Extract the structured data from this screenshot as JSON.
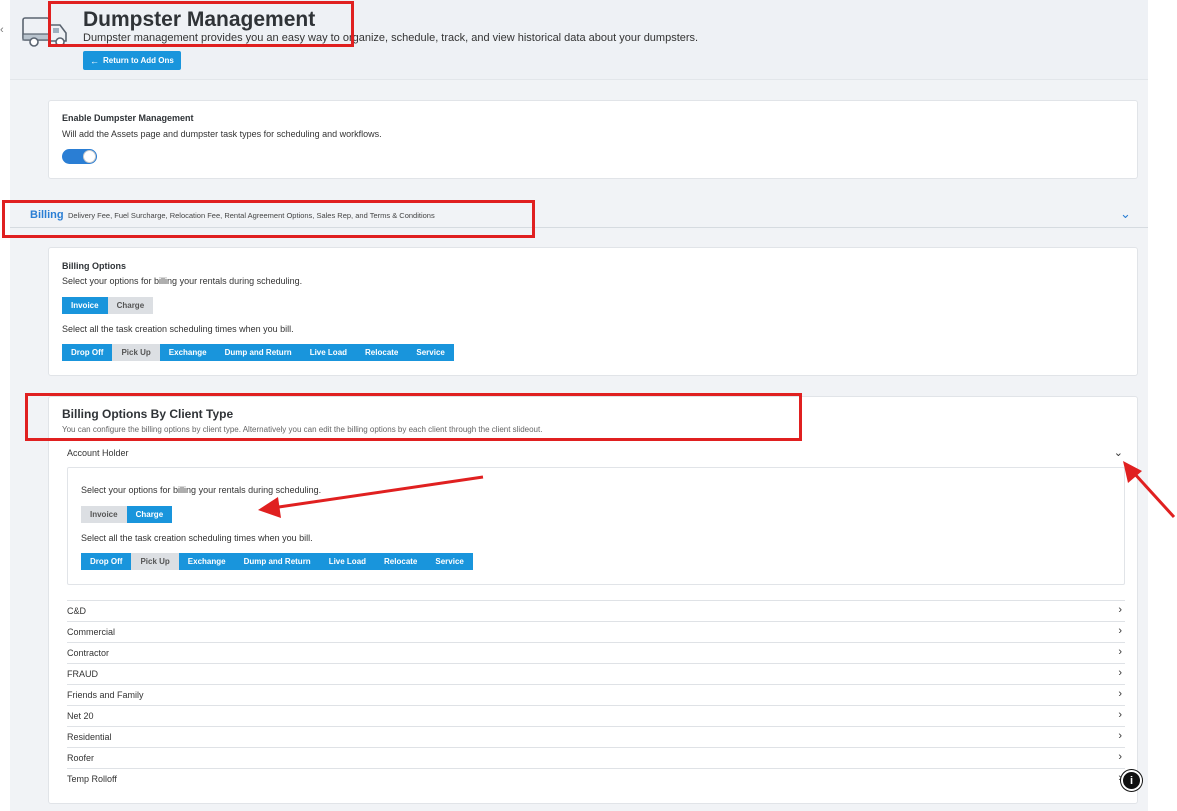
{
  "header": {
    "title": "Dumpster Management",
    "subtitle": "Dumpster management provides you an easy way to organize, schedule, track, and view historical data about your dumpsters.",
    "back_label": "Return to Add Ons",
    "logo_icon": "dumpster-truck-icon"
  },
  "enable_card": {
    "title": "Enable Dumpster Management",
    "description": "Will add the Assets page and dumpster task types for scheduling and workflows.",
    "enabled": true
  },
  "billing_section": {
    "name": "Billing",
    "description": "Delivery Fee, Fuel Surcharge, Relocation Fee, Rental Agreement Options, Sales Rep, and Terms & Conditions",
    "expanded": true
  },
  "billing_options": {
    "title": "Billing Options",
    "prompt": "Select your options for billing your rentals during scheduling.",
    "bill_types": [
      {
        "label": "Invoice",
        "selected": true
      },
      {
        "label": "Charge",
        "selected": false
      }
    ],
    "times_prompt": "Select all the task creation scheduling times when you bill.",
    "task_types": [
      {
        "label": "Drop Off",
        "selected": true
      },
      {
        "label": "Pick Up",
        "selected": false
      },
      {
        "label": "Exchange",
        "selected": true
      },
      {
        "label": "Dump and Return",
        "selected": true
      },
      {
        "label": "Live Load",
        "selected": true
      },
      {
        "label": "Relocate",
        "selected": true
      },
      {
        "label": "Service",
        "selected": true
      }
    ]
  },
  "client_type_billing": {
    "title": "Billing Options By Client Type",
    "description": "You can configure the billing options by client type. Alternatively you can edit the billing options by each client through the client slideout.",
    "expanded_client": {
      "name": "Account Holder",
      "prompt": "Select your options for billing your rentals during scheduling.",
      "bill_types": [
        {
          "label": "Invoice",
          "selected": false
        },
        {
          "label": "Charge",
          "selected": true
        }
      ],
      "times_prompt": "Select all the task creation scheduling times when you bill.",
      "task_types": [
        {
          "label": "Drop Off",
          "selected": true
        },
        {
          "label": "Pick Up",
          "selected": false
        },
        {
          "label": "Exchange",
          "selected": true
        },
        {
          "label": "Dump and Return",
          "selected": true
        },
        {
          "label": "Live Load",
          "selected": true
        },
        {
          "label": "Relocate",
          "selected": true
        },
        {
          "label": "Service",
          "selected": true
        }
      ]
    },
    "clients": [
      "C&D",
      "Commercial",
      "Contractor",
      "FRAUD",
      "Friends and Family",
      "Net 20",
      "Residential",
      "Roofer",
      "Temp Rolloff"
    ]
  },
  "colors": {
    "accent": "#1995dc",
    "annotation": "#e02020"
  }
}
